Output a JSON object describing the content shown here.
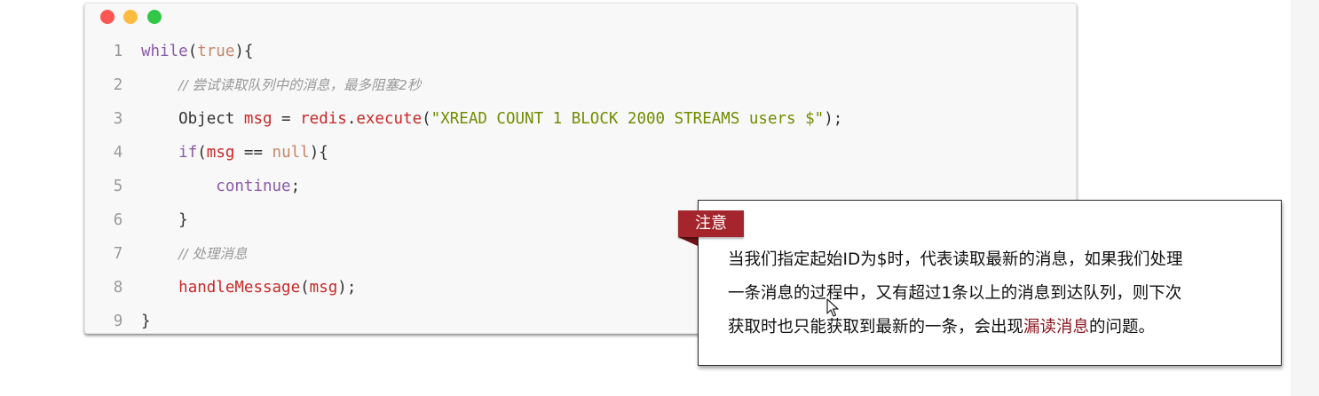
{
  "code_window": {
    "lines": [
      {
        "num": "1",
        "tokens": [
          {
            "t": "while",
            "c": "kw"
          },
          {
            "t": "(",
            "c": "pl"
          },
          {
            "t": "true",
            "c": "lit"
          },
          {
            "t": "){",
            "c": "pl"
          }
        ]
      },
      {
        "num": "2",
        "tokens": [
          {
            "t": "    ",
            "c": "pl"
          },
          {
            "t": "// 尝试读取队列中的消息，最多阻塞2秒",
            "c": "cm"
          }
        ]
      },
      {
        "num": "3",
        "tokens": [
          {
            "t": "    Object ",
            "c": "pl"
          },
          {
            "t": "msg",
            "c": "fn"
          },
          {
            "t": " = ",
            "c": "pl"
          },
          {
            "t": "redis",
            "c": "fn"
          },
          {
            "t": ".",
            "c": "pl"
          },
          {
            "t": "execute",
            "c": "fn"
          },
          {
            "t": "(",
            "c": "pl"
          },
          {
            "t": "\"XREAD COUNT 1 BLOCK 2000 STREAMS users $\"",
            "c": "str"
          },
          {
            "t": ");",
            "c": "pl"
          }
        ]
      },
      {
        "num": "4",
        "tokens": [
          {
            "t": "    ",
            "c": "pl"
          },
          {
            "t": "if",
            "c": "kw"
          },
          {
            "t": "(",
            "c": "pl"
          },
          {
            "t": "msg",
            "c": "fn"
          },
          {
            "t": " == ",
            "c": "pl"
          },
          {
            "t": "null",
            "c": "lit"
          },
          {
            "t": "){",
            "c": "pl"
          }
        ]
      },
      {
        "num": "5",
        "tokens": [
          {
            "t": "        ",
            "c": "pl"
          },
          {
            "t": "continue",
            "c": "kw"
          },
          {
            "t": ";",
            "c": "pl"
          }
        ]
      },
      {
        "num": "6",
        "tokens": [
          {
            "t": "    }",
            "c": "pl"
          }
        ]
      },
      {
        "num": "7",
        "tokens": [
          {
            "t": "    ",
            "c": "pl"
          },
          {
            "t": "// 处理消息",
            "c": "cm"
          }
        ]
      },
      {
        "num": "8",
        "tokens": [
          {
            "t": "    ",
            "c": "pl"
          },
          {
            "t": "handleMessage",
            "c": "fn"
          },
          {
            "t": "(",
            "c": "pl"
          },
          {
            "t": "msg",
            "c": "fn"
          },
          {
            "t": ");",
            "c": "pl"
          }
        ]
      },
      {
        "num": "9",
        "tokens": [
          {
            "t": "}",
            "c": "pl"
          }
        ]
      }
    ]
  },
  "note": {
    "tag": "注意",
    "line1": "当我们指定起始ID为$时，代表读取最新的消息，如果我们处理",
    "line2": "一条消息的过程中，又有超过1条以上的消息到达队列，则下次",
    "line3_before": "获取时也只能获取到最新的一条，会出现",
    "line3_highlight": "漏读消息",
    "line3_after": "的问题。"
  },
  "colors": {
    "dot_red": "#fc5753",
    "dot_yellow": "#fdbc40",
    "dot_green": "#33c748",
    "tag_bg": "#a4262c",
    "highlight_text": "#8b1a22"
  }
}
